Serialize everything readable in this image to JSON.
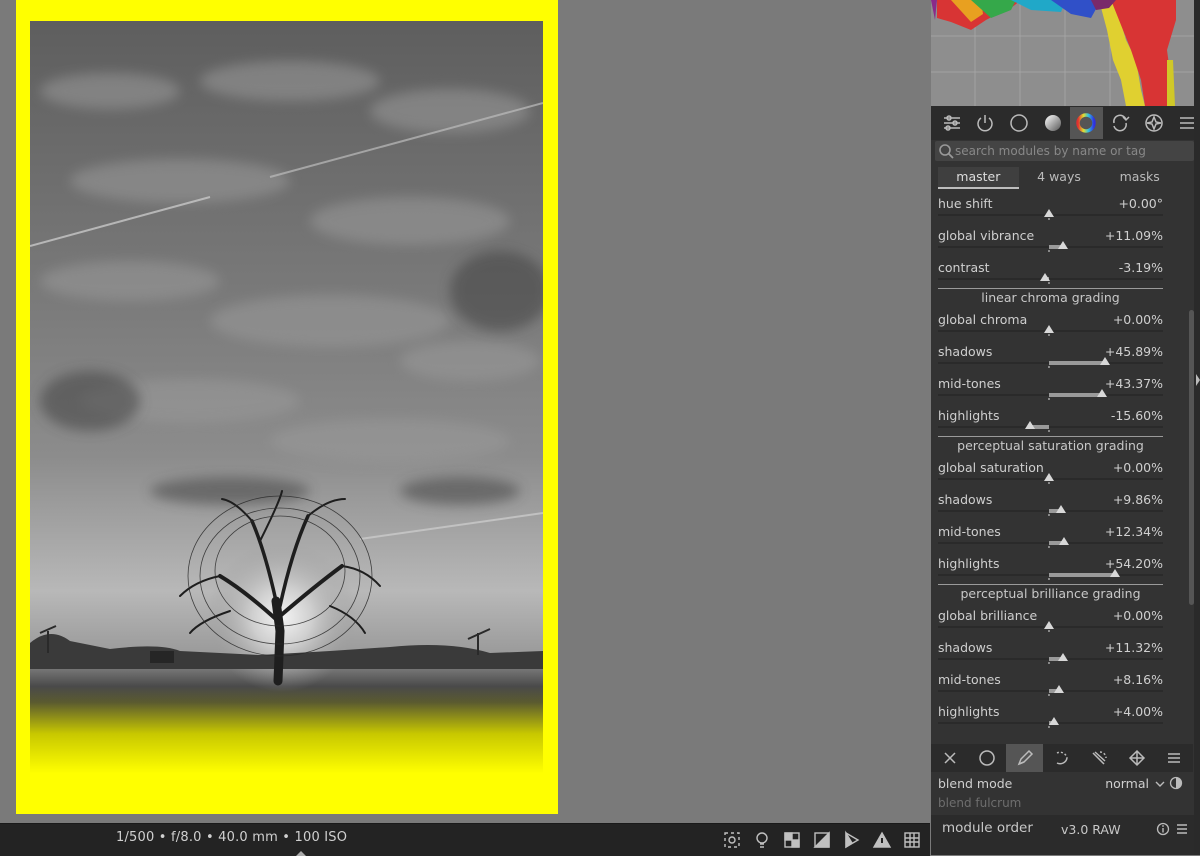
{
  "center": {
    "exif": "1/500 • f/8.0 • 40.0 mm • 100 ISO"
  },
  "panel": {
    "search_placeholder": "search modules by name or tag",
    "tabs": [
      "master",
      "4 ways",
      "masks"
    ],
    "active_tab": "master",
    "master_rows": [
      {
        "label": "hue shift",
        "value": "+0.00°",
        "level": 0.0
      },
      {
        "label": "global vibrance",
        "value": "+11.09%",
        "level": 11.09
      },
      {
        "label": "contrast",
        "value": "-3.19%",
        "level": -3.19
      }
    ],
    "sections": [
      {
        "title": "linear chroma grading",
        "rows": [
          {
            "label": "global chroma",
            "value": "+0.00%",
            "level": 0.0
          },
          {
            "label": "shadows",
            "value": "+45.89%",
            "level": 45.89
          },
          {
            "label": "mid-tones",
            "value": "+43.37%",
            "level": 43.37
          },
          {
            "label": "highlights",
            "value": "-15.60%",
            "level": -15.6
          }
        ]
      },
      {
        "title": "perceptual saturation grading",
        "rows": [
          {
            "label": "global saturation",
            "value": "+0.00%",
            "level": 0.0
          },
          {
            "label": "shadows",
            "value": "+9.86%",
            "level": 9.86
          },
          {
            "label": "mid-tones",
            "value": "+12.34%",
            "level": 12.34
          },
          {
            "label": "highlights",
            "value": "+54.20%",
            "level": 54.2
          }
        ]
      },
      {
        "title": "perceptual brilliance grading",
        "rows": [
          {
            "label": "global brilliance",
            "value": "+0.00%",
            "level": 0.0
          },
          {
            "label": "shadows",
            "value": "+11.32%",
            "level": 11.32
          },
          {
            "label": "mid-tones",
            "value": "+8.16%",
            "level": 8.16
          },
          {
            "label": "highlights",
            "value": "+4.00%",
            "level": 4.0
          }
        ]
      }
    ],
    "blend": {
      "mode_label": "blend mode",
      "mode_value": "normal",
      "fulcrum_label": "blend fulcrum"
    },
    "module_order": {
      "label": "module order",
      "value": "v3.0 RAW"
    }
  }
}
